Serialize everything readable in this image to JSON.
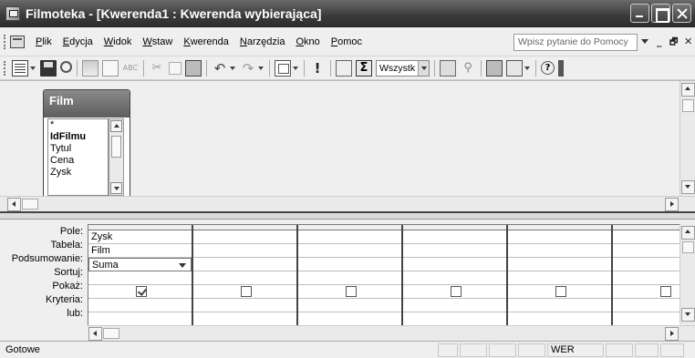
{
  "window": {
    "title": "Filmoteka - [Kwerenda1 : Kwerenda wybierająca]"
  },
  "menu": {
    "items": [
      "Plik",
      "Edycja",
      "Widok",
      "Wstaw",
      "Kwerenda",
      "Narzędzia",
      "Okno",
      "Pomoc"
    ],
    "help_placeholder": "Wpisz pytanie do Pomocy"
  },
  "toolbar": {
    "top_values_combo": "Wszystk"
  },
  "field_list": {
    "table_name": "Film",
    "fields": [
      "*",
      "IdFilmu",
      "Tytul",
      "Cena",
      "Zysk"
    ]
  },
  "qbe_grid": {
    "row_labels": [
      "Pole:",
      "Tabela:",
      "Podsumowanie:",
      "Sortuj:",
      "Pokaż:",
      "Kryteria:",
      "lub:"
    ],
    "columns": [
      {
        "field": "Zysk",
        "table": "Film",
        "total": "Suma",
        "sort": "",
        "show": true,
        "criteria": "",
        "or": ""
      },
      {
        "field": "",
        "table": "",
        "total": "",
        "sort": "",
        "show": false,
        "criteria": "",
        "or": ""
      },
      {
        "field": "",
        "table": "",
        "total": "",
        "sort": "",
        "show": false,
        "criteria": "",
        "or": ""
      },
      {
        "field": "",
        "table": "",
        "total": "",
        "sort": "",
        "show": false,
        "criteria": "",
        "or": ""
      },
      {
        "field": "",
        "table": "",
        "total": "",
        "sort": "",
        "show": false,
        "criteria": "",
        "or": ""
      },
      {
        "field": "",
        "table": "",
        "total": "",
        "sort": "",
        "show": false,
        "criteria": "",
        "or": ""
      }
    ]
  },
  "statusbar": {
    "text": "Gotowe",
    "mode_indicator": "WER"
  }
}
